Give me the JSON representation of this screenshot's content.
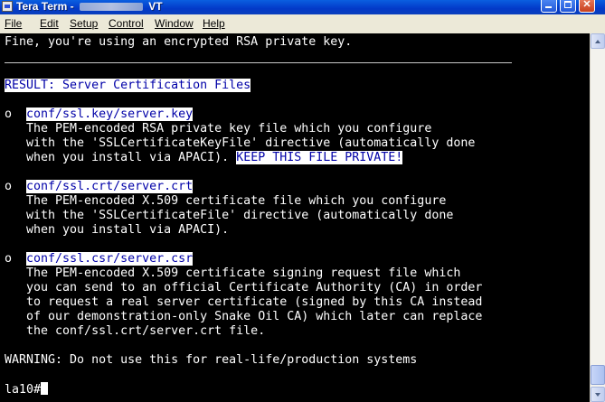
{
  "window": {
    "title_prefix": "Tera Term - ",
    "title_suffix": " VT"
  },
  "menu": [
    {
      "label": "File"
    },
    {
      "label": "Edit"
    },
    {
      "label": "Setup"
    },
    {
      "label": "Control"
    },
    {
      "label": "Window"
    },
    {
      "label": "Help"
    }
  ],
  "terminal": {
    "lines": [
      {
        "segments": [
          {
            "text": "Fine, you're using an encrypted RSA private key."
          }
        ]
      },
      {
        "segments": [
          {
            "text": ""
          }
        ]
      },
      {
        "segments": [
          {
            "text": ""
          }
        ]
      },
      {
        "segments": [
          {
            "text": "RESULT: Server Certification Files",
            "hl": true
          }
        ]
      },
      {
        "segments": [
          {
            "text": ""
          }
        ]
      },
      {
        "segments": [
          {
            "text": "o  "
          },
          {
            "text": "conf/ssl.key/server.key",
            "hl": true
          }
        ]
      },
      {
        "segments": [
          {
            "text": "   The PEM-encoded RSA private key file which you configure"
          }
        ]
      },
      {
        "segments": [
          {
            "text": "   with the 'SSLCertificateKeyFile' directive (automatically done"
          }
        ]
      },
      {
        "segments": [
          {
            "text": "   when you install via APACI). "
          },
          {
            "text": "KEEP THIS FILE PRIVATE!",
            "hl": true
          }
        ]
      },
      {
        "segments": [
          {
            "text": ""
          }
        ]
      },
      {
        "segments": [
          {
            "text": "o  "
          },
          {
            "text": "conf/ssl.crt/server.crt",
            "hl": true
          }
        ]
      },
      {
        "segments": [
          {
            "text": "   The PEM-encoded X.509 certificate file which you configure"
          }
        ]
      },
      {
        "segments": [
          {
            "text": "   with the 'SSLCertificateFile' directive (automatically done"
          }
        ]
      },
      {
        "segments": [
          {
            "text": "   when you install via APACI)."
          }
        ]
      },
      {
        "segments": [
          {
            "text": ""
          }
        ]
      },
      {
        "segments": [
          {
            "text": "o  "
          },
          {
            "text": "conf/ssl.csr/server.csr",
            "hl": true
          }
        ]
      },
      {
        "segments": [
          {
            "text": "   The PEM-encoded X.509 certificate signing request file which"
          }
        ]
      },
      {
        "segments": [
          {
            "text": "   you can send to an official Certificate Authority (CA) in order"
          }
        ]
      },
      {
        "segments": [
          {
            "text": "   to request a real server certificate (signed by this CA instead"
          }
        ]
      },
      {
        "segments": [
          {
            "text": "   of our demonstration-only Snake Oil CA) which later can replace"
          }
        ]
      },
      {
        "segments": [
          {
            "text": "   the conf/ssl.crt/server.crt file."
          }
        ]
      },
      {
        "segments": [
          {
            "text": ""
          }
        ]
      },
      {
        "segments": [
          {
            "text": "WARNING: Do not use this for real-life/production systems"
          }
        ]
      },
      {
        "segments": [
          {
            "text": ""
          }
        ]
      },
      {
        "segments": [
          {
            "text": "la10#"
          }
        ],
        "cursor": true
      }
    ]
  },
  "colors": {
    "terminal_bg": "#000000",
    "terminal_fg": "#ffffff",
    "highlight_bg": "#ffffff",
    "highlight_fg": "#0000a8"
  }
}
